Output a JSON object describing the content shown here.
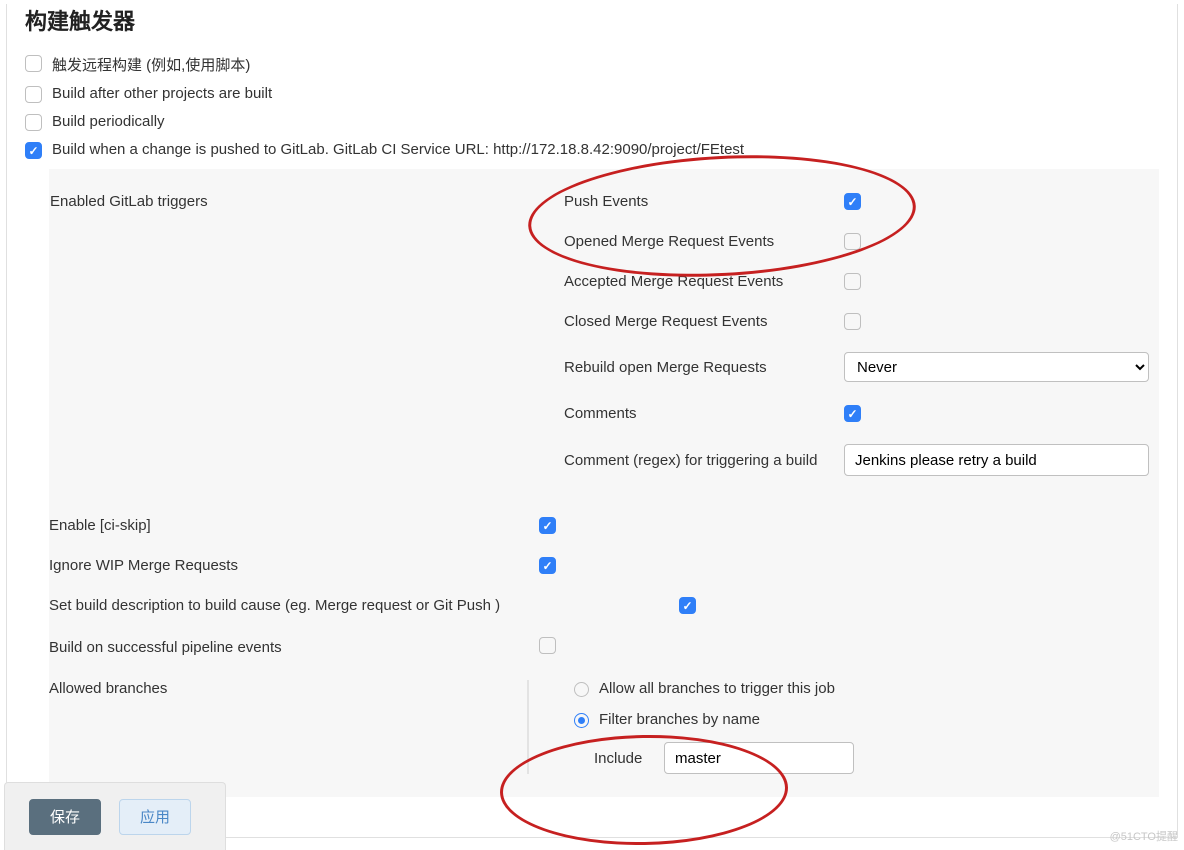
{
  "section_title": "构建触发器",
  "triggers": {
    "remote": {
      "label": "触发远程构建 (例如,使用脚本)",
      "checked": false
    },
    "after_projects": {
      "label": "Build after other projects are built",
      "checked": false
    },
    "periodic": {
      "label": "Build periodically",
      "checked": false
    },
    "gitlab": {
      "label": "Build when a change is pushed to GitLab. GitLab CI Service URL: http://172.18.8.42:9090/project/FEtest",
      "checked": true
    }
  },
  "gitlab_triggers": {
    "heading": "Enabled GitLab triggers",
    "push_events": {
      "label": "Push Events",
      "checked": true
    },
    "opened_mr": {
      "label": "Opened Merge Request Events",
      "checked": false
    },
    "accepted_mr": {
      "label": "Accepted Merge Request Events",
      "checked": false
    },
    "closed_mr": {
      "label": "Closed Merge Request Events",
      "checked": false
    },
    "rebuild_open_mr": {
      "label": "Rebuild open Merge Requests",
      "value": "Never"
    },
    "comments": {
      "label": "Comments",
      "checked": true
    },
    "comment_regex": {
      "label": "Comment (regex) for triggering a build",
      "value": "Jenkins please retry a build"
    }
  },
  "options": {
    "ci_skip": {
      "label": "Enable [ci-skip]",
      "checked": true
    },
    "ignore_wip": {
      "label": "Ignore WIP Merge Requests",
      "checked": true
    },
    "set_desc": {
      "label": "Set build description to build cause (eg. Merge request or Git Push )",
      "checked": true
    },
    "pipeline_events": {
      "label": "Build on successful pipeline events",
      "checked": false
    }
  },
  "branches": {
    "heading": "Allowed branches",
    "allow_all": {
      "label": "Allow all branches to trigger this job",
      "selected": false
    },
    "filter_name": {
      "label": "Filter branches by name",
      "selected": true
    },
    "include": {
      "label": "Include",
      "value": "master"
    }
  },
  "buttons": {
    "save": "保存",
    "apply": "应用"
  },
  "watermark": "@51CTO提醒"
}
